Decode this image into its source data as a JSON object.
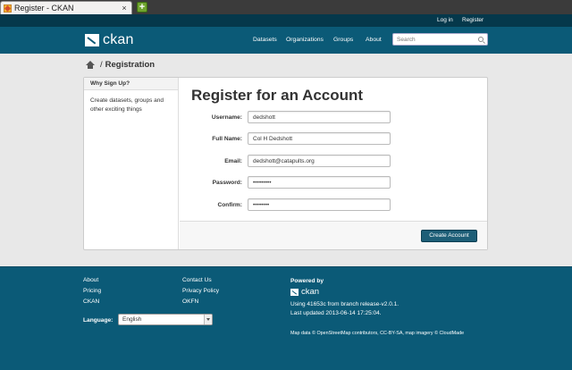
{
  "browser": {
    "tab_title": "Register - CKAN",
    "tab_close": "×",
    "new_tab": "+"
  },
  "account": {
    "login": "Log in",
    "register": "Register"
  },
  "header": {
    "logo_text": "ckan",
    "nav": [
      "Datasets",
      "Organizations",
      "Groups",
      "About"
    ],
    "search_placeholder": "Search"
  },
  "breadcrumb": {
    "separator": "/",
    "current": "Registration"
  },
  "aside": {
    "title": "Why Sign Up?",
    "text": "Create datasets, groups and other exciting things"
  },
  "form": {
    "title": "Register for an Account",
    "fields": [
      {
        "label": "Username:",
        "value": "dedshott",
        "type": "text"
      },
      {
        "label": "Full Name:",
        "value": "Col H Dedshott",
        "type": "text"
      },
      {
        "label": "Email:",
        "value": "dedshott@catapults.org",
        "type": "text"
      },
      {
        "label": "Password:",
        "value": "•••••••••",
        "type": "text"
      },
      {
        "label": "Confirm:",
        "value": "••••••••",
        "type": "text"
      }
    ],
    "submit_label": "Create Account"
  },
  "footer": {
    "col1": [
      "About",
      "Pricing",
      "CKAN"
    ],
    "col2": [
      "Contact Us",
      "Privacy Policy",
      "OKFN"
    ],
    "language_label": "Language:",
    "language_value": "English",
    "powered_by": "Powered by",
    "logo_text": "ckan",
    "version_line1": "Using 41653c from branch release-v2.0.1.",
    "version_line2": "Last updated 2013-06-14 17:25:04.",
    "attribution": "Map data © OpenStreetMap contributors, CC-BY-SA, map imagery © CloudMade"
  }
}
